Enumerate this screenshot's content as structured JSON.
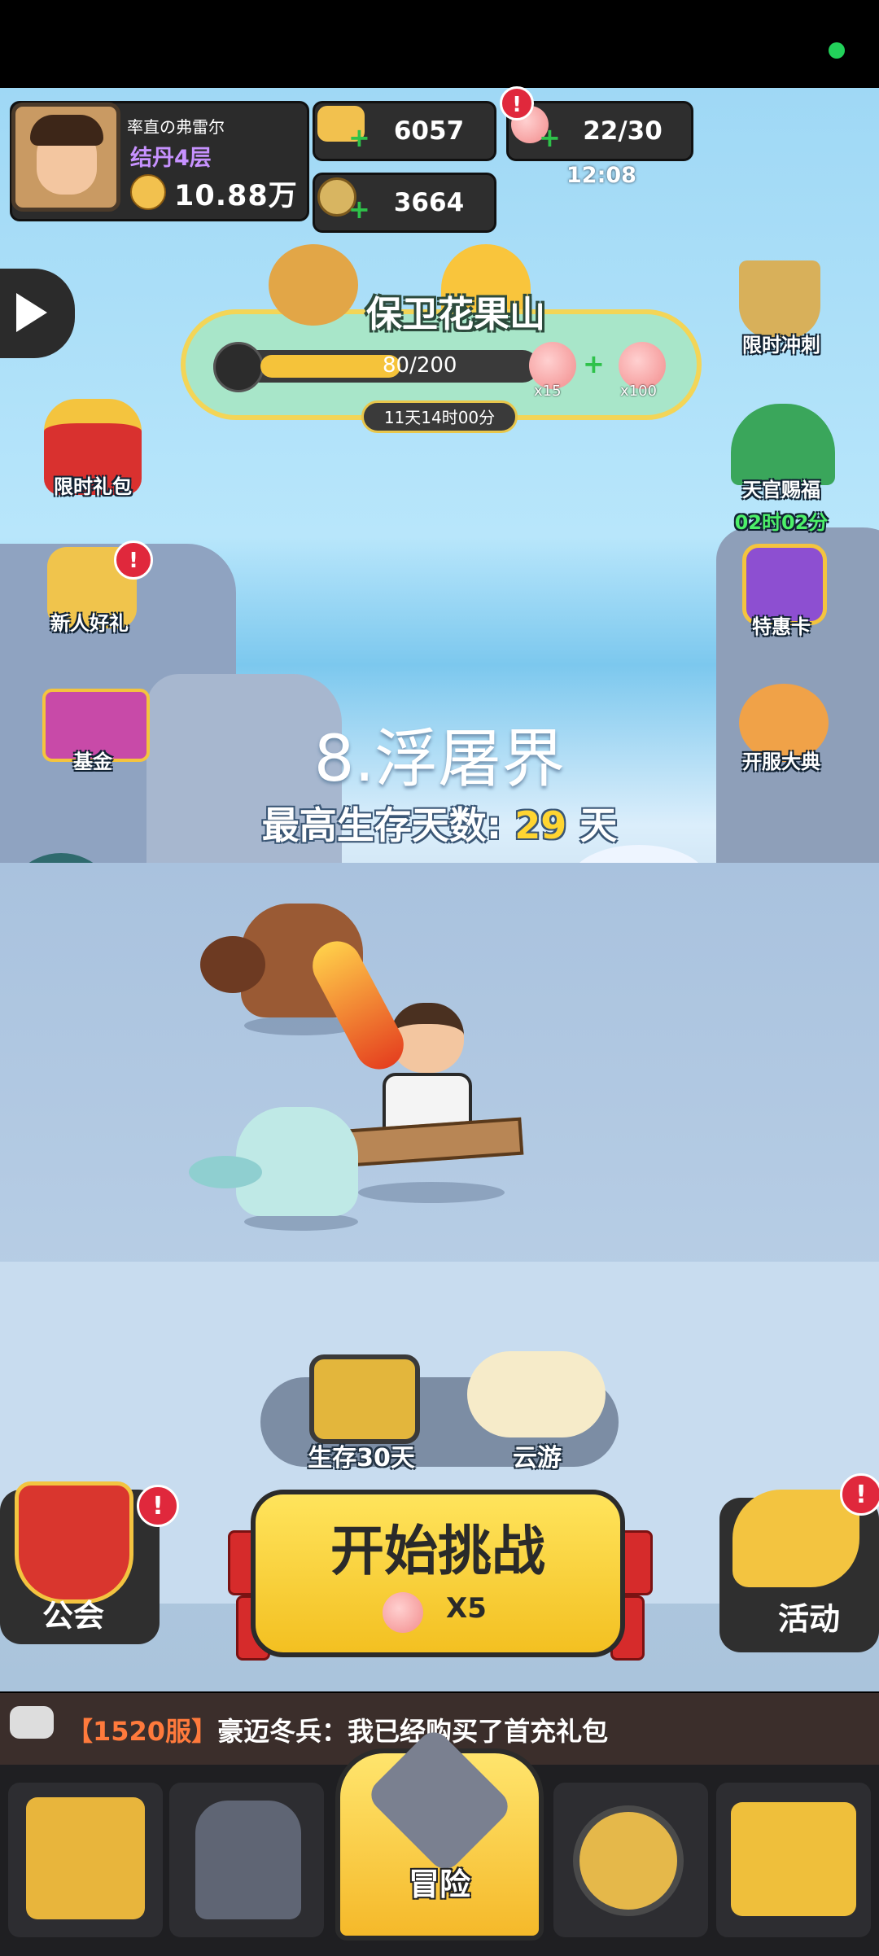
{
  "player": {
    "name": "率直の弗雷尔",
    "rank": "结丹4层",
    "power": "10.88万"
  },
  "resources": {
    "gold": "6057",
    "coins": "3664",
    "stamina": "22/30",
    "stamina_timer": "12:08"
  },
  "event": {
    "title": "保卫花果山",
    "progress": "80/200",
    "reward1": "x15",
    "reward2": "x100",
    "countdown": "11天14时00分"
  },
  "left_menu": [
    {
      "label": "限时礼包"
    },
    {
      "label": "新人好礼"
    },
    {
      "label": "基金"
    }
  ],
  "right_menu": [
    {
      "label": "限时冲刺"
    },
    {
      "label": "天官赐福",
      "timer": "02时02分"
    },
    {
      "label": "特惠卡"
    },
    {
      "label": "开服大典"
    }
  ],
  "stage": {
    "name": "8.浮屠界",
    "record_label": "最高生存天数:",
    "record_days": "29",
    "record_unit": "天"
  },
  "modes": [
    {
      "label": "生存30天"
    },
    {
      "label": "云游"
    }
  ],
  "actions": {
    "guild": "公会",
    "start": "开始挑战",
    "cost": "X5",
    "activity": "活动"
  },
  "chat": {
    "server": "【1520服】",
    "message": "豪迈冬兵：我已经购买了首充礼包"
  },
  "nav": {
    "active_label": "冒险"
  },
  "badge_mark": "!",
  "colors": {
    "accent": "#f5c33a",
    "badge": "#e0283c",
    "plus": "#2ec24a",
    "rank": "#c792ff"
  }
}
